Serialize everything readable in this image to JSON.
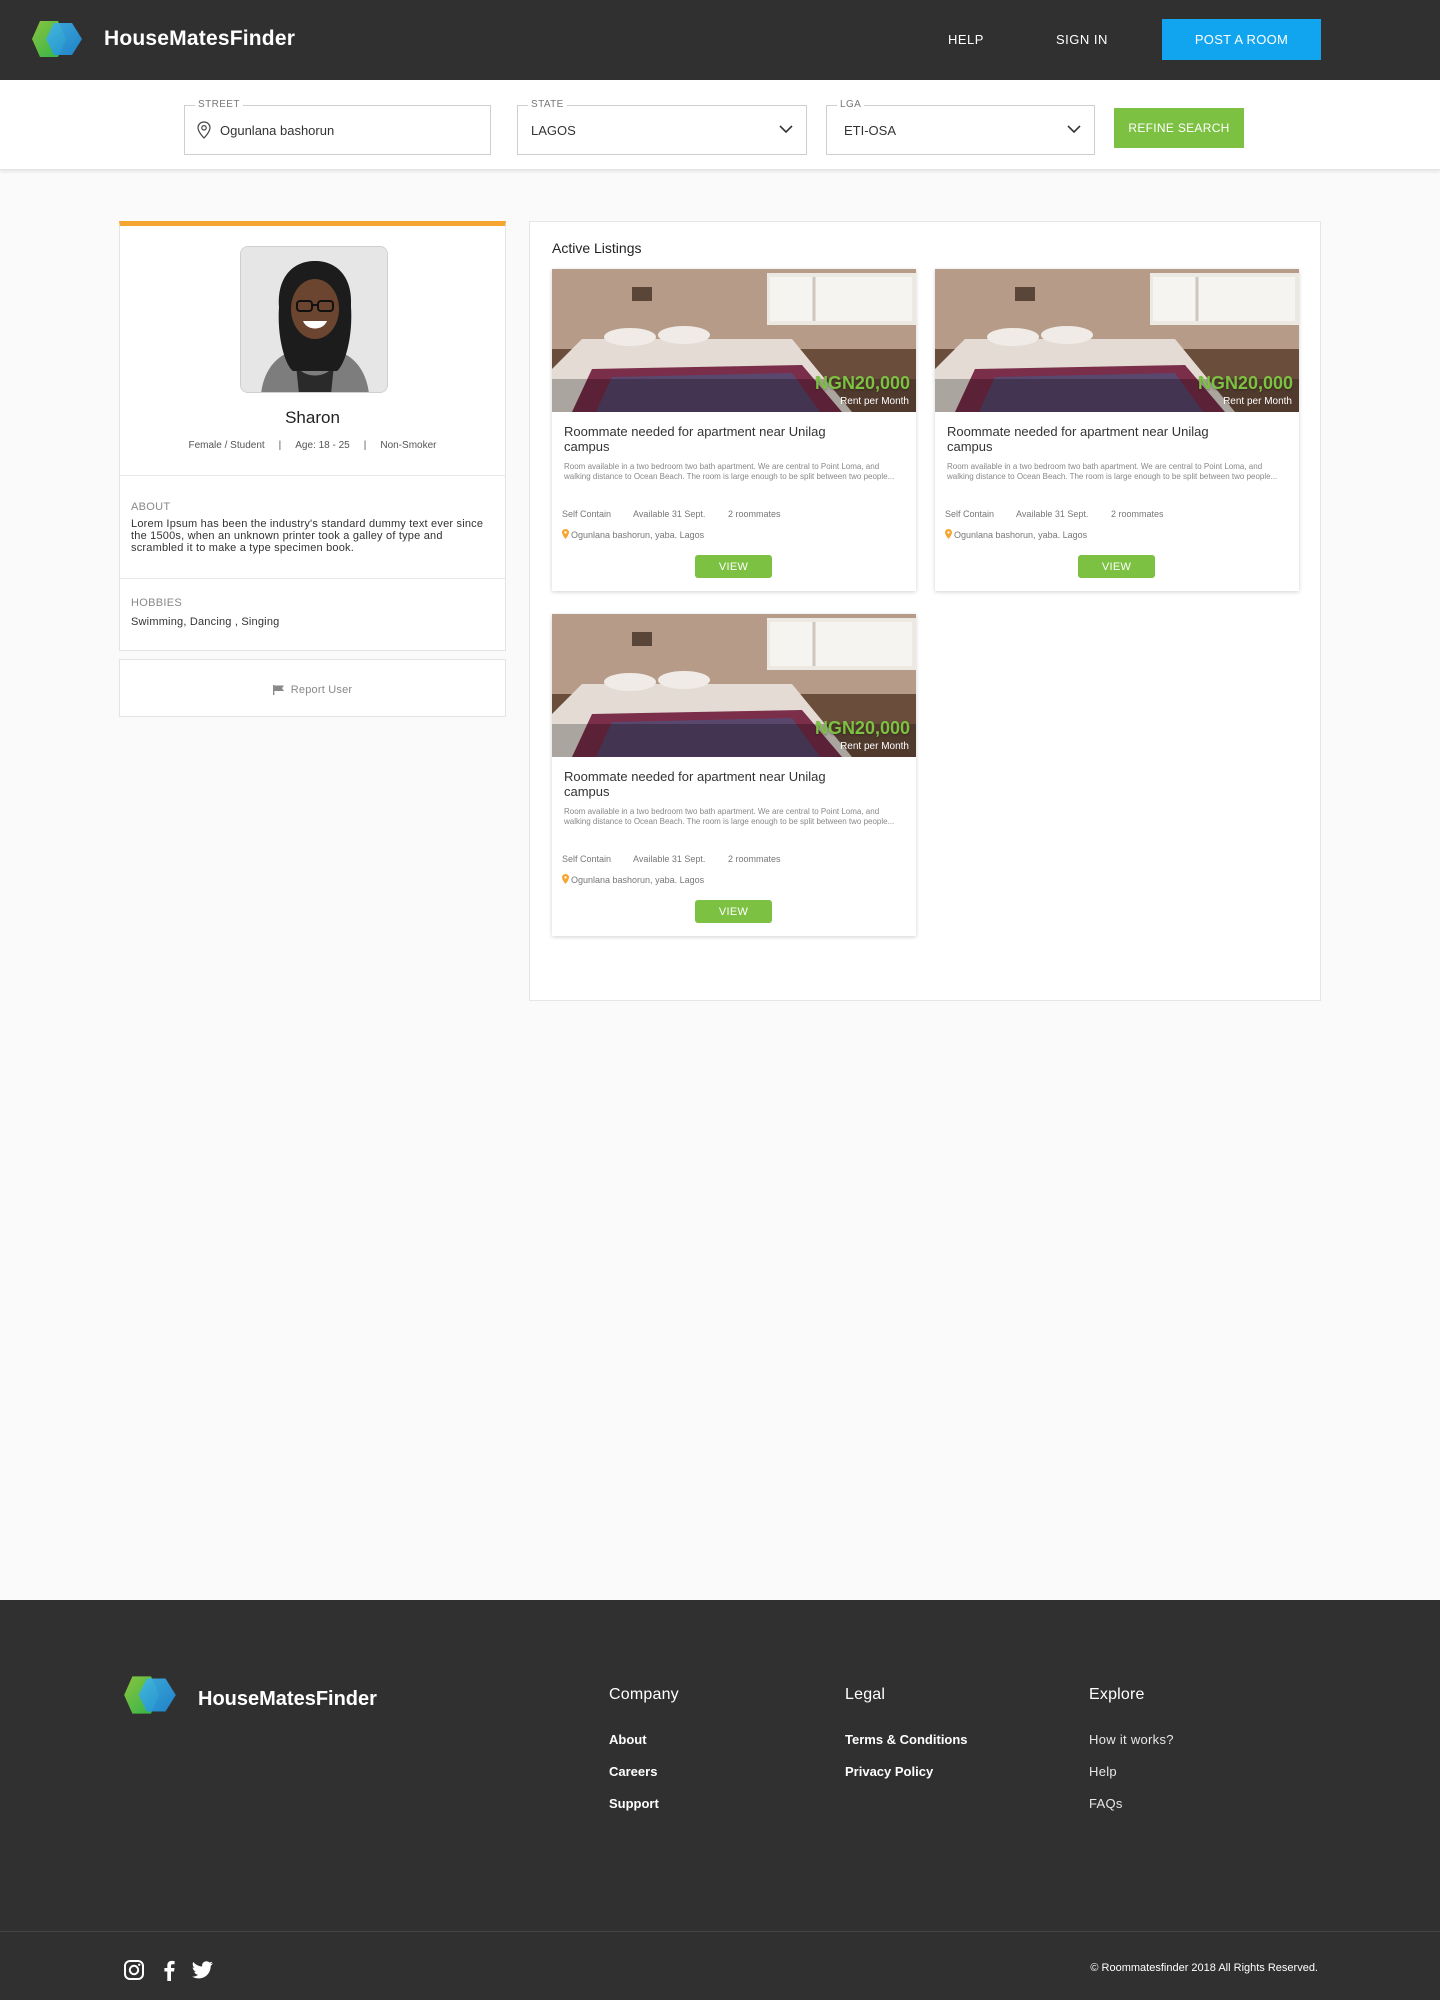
{
  "header": {
    "brand": "HouseMatesFinder",
    "nav": {
      "help": "HELP",
      "sign_in": "SIGN IN"
    },
    "post_room_label": "POST A ROOM",
    "colors": {
      "bar": "#303030",
      "accent": "#12a5ef"
    }
  },
  "search": {
    "street_label": "STREET",
    "street_value": "Ogunlana bashorun",
    "state_label": "STATE",
    "state_value": "LAGOS",
    "lga_label": "LGA",
    "lga_value": "ETI-OSA",
    "refine_label": "REFINE SEARCH"
  },
  "profile": {
    "name": "Sharon",
    "gender_occupation": "Female / Student",
    "meta_separator": "|",
    "age": "Age: 18 - 25",
    "smoker": "Non-Smoker",
    "about_title": "ABOUT",
    "about_text": "Lorem Ipsum has been the industry's standard dummy text ever since the 1500s, when an unknown printer took a galley of type and scrambled it to make a type specimen book.",
    "hobbies_title": "HOBBIES",
    "hobbies_text": "Swimming, Dancing , Singing",
    "report_label": "Report User",
    "accent_color": "#f7a531"
  },
  "listings": {
    "title": "Active Listings",
    "items": [
      {
        "price": "NGN20,000",
        "rent_period": "Rent per Month",
        "title": "Roommate needed for apartment near Unilag campus",
        "description": "Room available in a two bedroom two bath apartment. We are central to Point Loma, and walking distance to Ocean Beach. The room is large enough to be split between two people...",
        "type": "Self Contain",
        "available": "Available 31 Sept.",
        "roommates": "2 roommates",
        "location": "Ogunlana bashorun, yaba. Lagos",
        "view_label": "VIEW"
      },
      {
        "price": "NGN20,000",
        "rent_period": "Rent per Month",
        "title": "Roommate needed for apartment near Unilag campus",
        "description": "Room available in a two bedroom two bath apartment. We are central to Point Loma, and walking distance to Ocean Beach. The room is large enough to be split between two people...",
        "type": "Self Contain",
        "available": "Available 31 Sept.",
        "roommates": "2 roommates",
        "location": "Ogunlana bashorun, yaba. Lagos",
        "view_label": "VIEW"
      },
      {
        "price": "NGN20,000",
        "rent_period": "Rent per Month",
        "title": "Roommate needed for apartment near Unilag campus",
        "description": "Room available in a two bedroom two bath apartment. We are central to Point Loma, and walking distance to Ocean Beach. The room is large enough to be split between two people...",
        "type": "Self Contain",
        "available": "Available 31 Sept.",
        "roommates": "2 roommates",
        "location": "Ogunlana bashorun, yaba. Lagos",
        "view_label": "VIEW"
      }
    ],
    "price_color": "#7dc142"
  },
  "footer": {
    "brand": "HouseMatesFinder",
    "company": {
      "title": "Company",
      "links": [
        "About",
        "Careers",
        "Support"
      ]
    },
    "legal": {
      "title": "Legal",
      "links": [
        "Terms & Conditions",
        "Privacy Policy"
      ]
    },
    "explore": {
      "title": "Explore",
      "links": [
        "How it works?",
        "Help",
        "FAQs"
      ]
    },
    "social_icons": [
      "instagram-icon",
      "facebook-icon",
      "twitter-icon"
    ],
    "copyright": "© Roommatesfinder 2018 All Rights Reserved."
  }
}
